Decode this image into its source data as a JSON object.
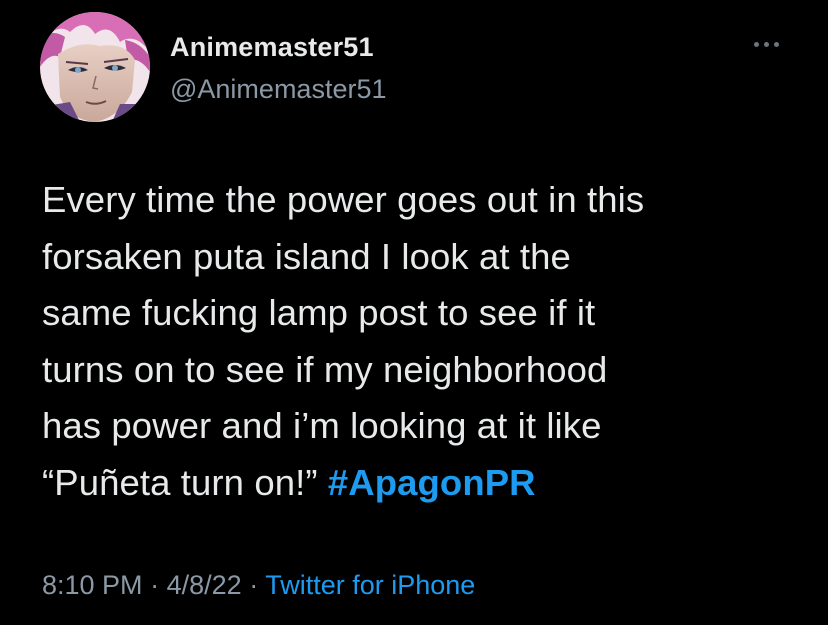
{
  "user": {
    "display_name": "Animemaster51",
    "handle": "@Animemaster51",
    "avatar_icon": "anime-avatar"
  },
  "more_icon": "ellipsis-icon",
  "tweet": {
    "lines": [
      "Every time the power goes out in this",
      "forsaken puta island I look at the",
      "same fucking lamp post to see if it",
      "turns on to see if my neighborhood",
      "has power and i’m looking at it like",
      "“Puñeta turn on!”"
    ],
    "hashtag": "#ApagonPR"
  },
  "meta": {
    "time": "8:10 PM",
    "separator_1": "·",
    "date": "4/8/22",
    "separator_2": "·",
    "source": "Twitter for iPhone"
  },
  "colors": {
    "background": "#000000",
    "text": "#e7e9ea",
    "secondary": "#8b98a5",
    "link": "#1d9bf0"
  }
}
